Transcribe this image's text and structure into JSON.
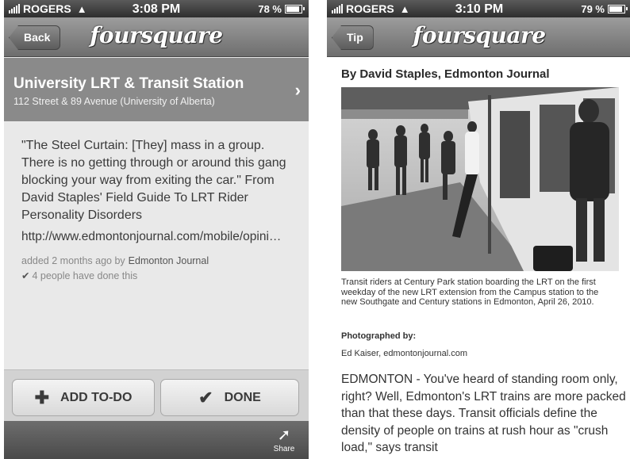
{
  "screens": [
    {
      "status": {
        "carrier": "ROGERS",
        "time": "3:08 PM",
        "battery": "78 %"
      },
      "nav": {
        "back": "Back",
        "logo": "foursquare"
      },
      "venue": {
        "name": "University LRT & Transit Station",
        "address": "112 Street & 89 Avenue (University of Alberta)",
        "chevron": "›"
      },
      "tip": {
        "text": "\"The Steel Curtain: [They] mass in a group. There is no getting through or around this gang blocking your way from exiting the car.\" From David Staples' Field Guide To LRT Rider Personality Disorders",
        "url": "http://www.edmontonjournal.com/mobile/opini…",
        "added": "added 2 months ago by",
        "author": "Edmonton Journal",
        "done_count": "4 people have done this"
      },
      "actions": {
        "add_todo": "ADD TO-DO",
        "done": "DONE"
      },
      "tabbar": {
        "share": "Share"
      }
    },
    {
      "status": {
        "carrier": "ROGERS",
        "time": "3:10 PM",
        "battery": "79 %"
      },
      "nav": {
        "back": "Tip",
        "logo": "foursquare"
      },
      "article": {
        "byline": "By David Staples, Edmonton Journal",
        "caption": "Transit riders at Century Park station boarding the LRT on the first weekday of the new LRT extension from the Campus station to the new Southgate and Century stations in Edmonton, April 26, 2010.",
        "credit_label": "Photographed by:",
        "credit": "Ed Kaiser, edmontonjournal.com",
        "body": "EDMONTON - You've heard of standing room only, right? Well, Edmonton's LRT trains are more packed than that these days. Transit officials define the density of people on trains at rush hour as \"crush load,\" says transit"
      }
    }
  ],
  "icons": {
    "wifi": "wifi-icon",
    "battery": "battery-icon",
    "chevron": "chevron-right-icon",
    "plus": "plus-icon",
    "check": "checkmark-icon",
    "share": "share-icon"
  }
}
